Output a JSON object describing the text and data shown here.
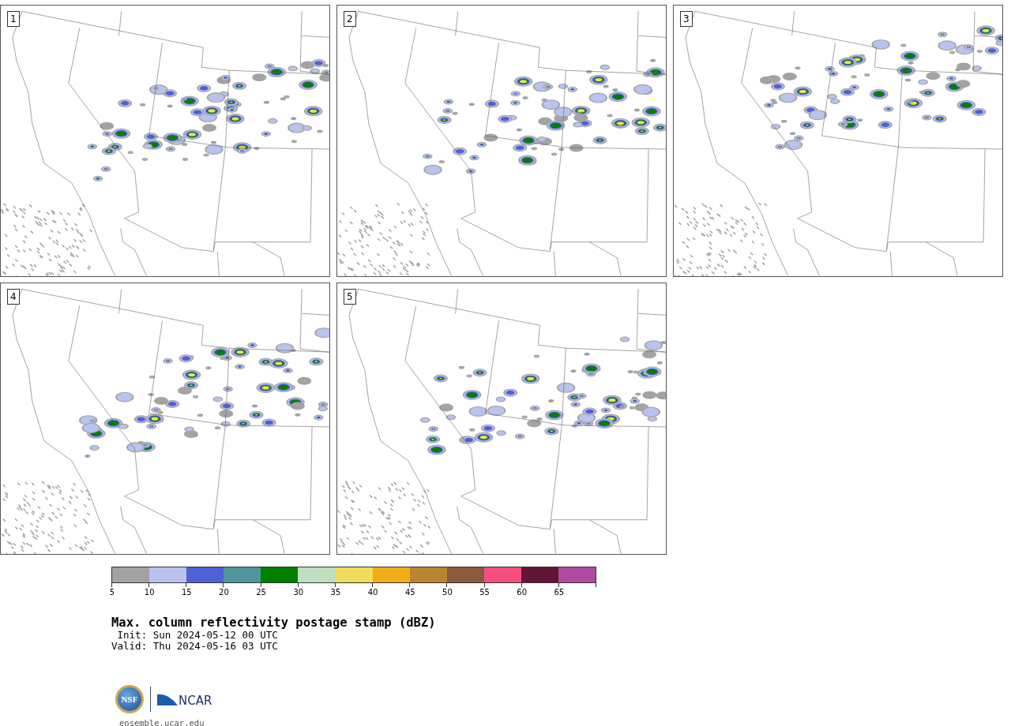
{
  "panels": [
    {
      "label": "1"
    },
    {
      "label": "2"
    },
    {
      "label": "3"
    },
    {
      "label": "4"
    },
    {
      "label": "5"
    }
  ],
  "colorbar": {
    "bins": [
      {
        "color": "#a3a3a3",
        "label": "5"
      },
      {
        "color": "#b8c3ef",
        "label": "10"
      },
      {
        "color": "#5060d6",
        "label": "15"
      },
      {
        "color": "#4f959a",
        "label": "20"
      },
      {
        "color": "#008000",
        "label": "25"
      },
      {
        "color": "#bfdfbe",
        "label": "30"
      },
      {
        "color": "#f1dc5d",
        "label": "35"
      },
      {
        "color": "#f0ad17",
        "label": "40"
      },
      {
        "color": "#b98431",
        "label": "45"
      },
      {
        "color": "#8a5a3e",
        "label": "50"
      },
      {
        "color": "#f74f7d",
        "label": "55"
      },
      {
        "color": "#601634",
        "label": "60"
      },
      {
        "color": "#b04ba4",
        "label": "65"
      }
    ]
  },
  "title": "Max. column reflectivity postage stamp (dBZ)",
  "init": " Init: Sun 2024-05-12 00 UTC",
  "valid": "Valid: Thu 2024-05-16 03 UTC",
  "logo": {
    "nsf": "NSF",
    "ncar": "NCAR"
  },
  "url": "ensemble.ucar.edu"
}
